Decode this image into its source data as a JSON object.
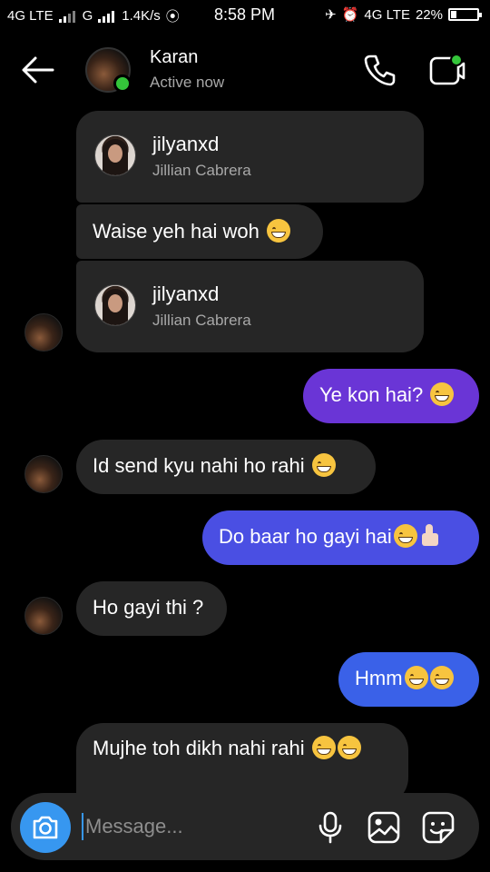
{
  "status_bar": {
    "network1": "4G LTE",
    "network2": "G",
    "speed": "1.4K/s",
    "time": "8:58 PM",
    "network3": "4G LTE",
    "battery": "22%",
    "battery_level": 0.22
  },
  "header": {
    "name": "Karan",
    "status": "Active now"
  },
  "messages": [
    {
      "type": "profile_share",
      "username": "jilyanxd",
      "full_name": "Jillian Cabrera"
    },
    {
      "type": "incoming",
      "text": "Waise yeh hai woh",
      "emoji": "grinning-squinting-face"
    },
    {
      "type": "profile_share",
      "username": "jilyanxd",
      "full_name": "Jillian Cabrera"
    },
    {
      "type": "outgoing",
      "text": "Ye kon hai?",
      "emoji": "grinning-squinting-face"
    },
    {
      "type": "incoming",
      "text": "Id send kyu nahi ho rahi",
      "emoji": "grinning-squinting-face"
    },
    {
      "type": "outgoing",
      "text": "Do baar ho gayi hai",
      "emoji": "grinning-squinting-face + thumbs-up"
    },
    {
      "type": "incoming",
      "text": "Ho gayi thi ?"
    },
    {
      "type": "outgoing",
      "text": "Hmm",
      "emoji": "grinning-squinting-face + grinning-squinting-face"
    },
    {
      "type": "incoming",
      "text": "Mujhe toh dikh nahi rahi",
      "emoji": "grinning-squinting-face + grinning-squinting-face"
    }
  ],
  "composer": {
    "placeholder": "Message..."
  },
  "colors": {
    "outgoing_top": "#6a35d6",
    "outgoing_bottom": "#3a61e8",
    "incoming": "#262626",
    "accent": "#3797f0",
    "online": "#34c53a"
  },
  "icons": [
    "back-arrow-icon",
    "phone-icon",
    "video-call-icon",
    "camera-icon",
    "microphone-icon",
    "gallery-icon",
    "sticker-icon"
  ]
}
